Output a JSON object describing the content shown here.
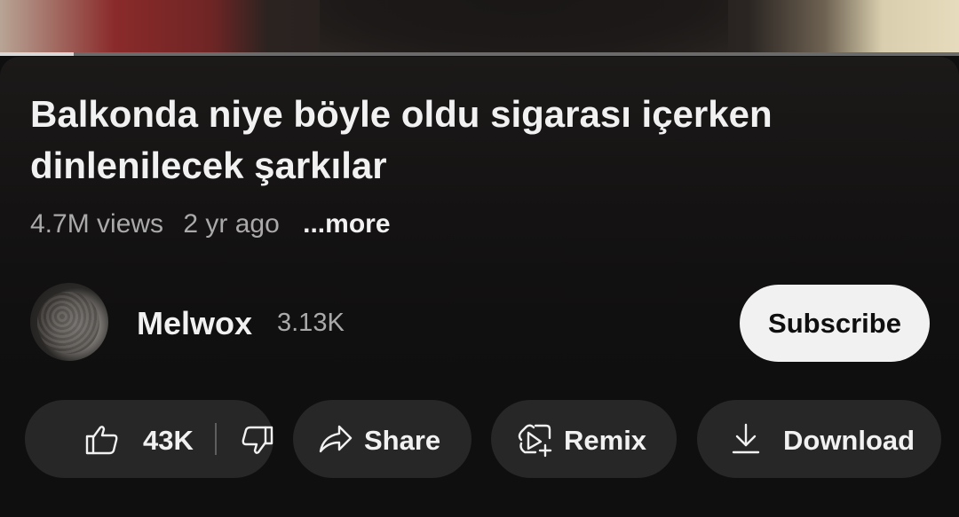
{
  "video": {
    "title": "Balkonda niye böyle oldu sigarası içerken dinlenilecek şarkılar",
    "progress_fraction": 0.077
  },
  "meta": {
    "views": "4.7M views",
    "age": "2 yr ago",
    "more_label": "...more"
  },
  "channel": {
    "name": "Melwox",
    "subscribers": "3.13K",
    "subscribe_label": "Subscribe"
  },
  "actions": {
    "like_count": "43K",
    "share_label": "Share",
    "remix_label": "Remix",
    "download_label": "Download"
  },
  "icons": {
    "like": "thumbs-up-icon",
    "dislike": "thumbs-down-icon",
    "share": "share-arrow-icon",
    "remix": "remix-icon",
    "download": "download-icon"
  },
  "colors": {
    "background": "#0f0f0f",
    "pill_background": "#272727",
    "subscribe_background": "#f1f1f1",
    "primary_text": "#f1f1f1",
    "secondary_text": "#aaaaaa"
  }
}
